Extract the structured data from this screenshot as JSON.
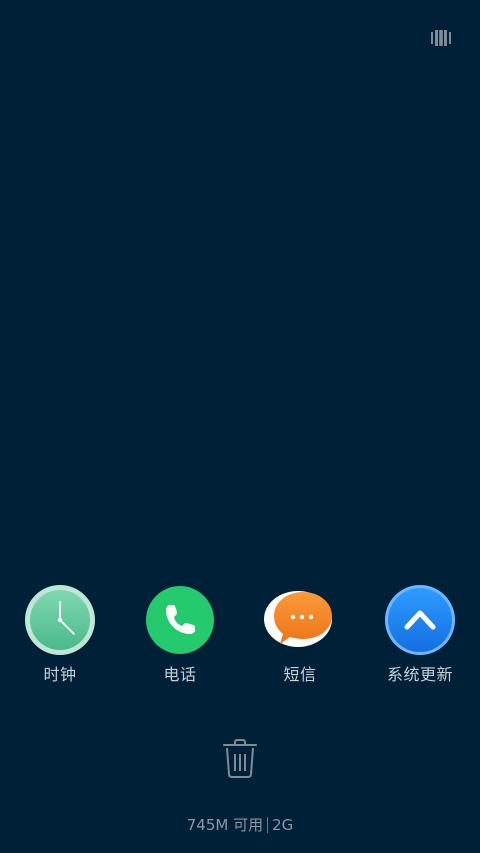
{
  "top_bar": {
    "toggle_icon": "overview-toggle-icon"
  },
  "apps": [
    {
      "label": "时钟",
      "icon": "clock-icon",
      "color": "#5bc49c"
    },
    {
      "label": "电话",
      "icon": "phone-icon",
      "color": "#25c96e"
    },
    {
      "label": "短信",
      "icon": "message-icon",
      "color": "#f58220"
    },
    {
      "label": "系统更新",
      "icon": "system-update-icon",
      "color": "#1f86f0"
    }
  ],
  "clear_button": {
    "icon": "trash-icon"
  },
  "memory": {
    "available": "745M 可用",
    "total": "2G"
  }
}
